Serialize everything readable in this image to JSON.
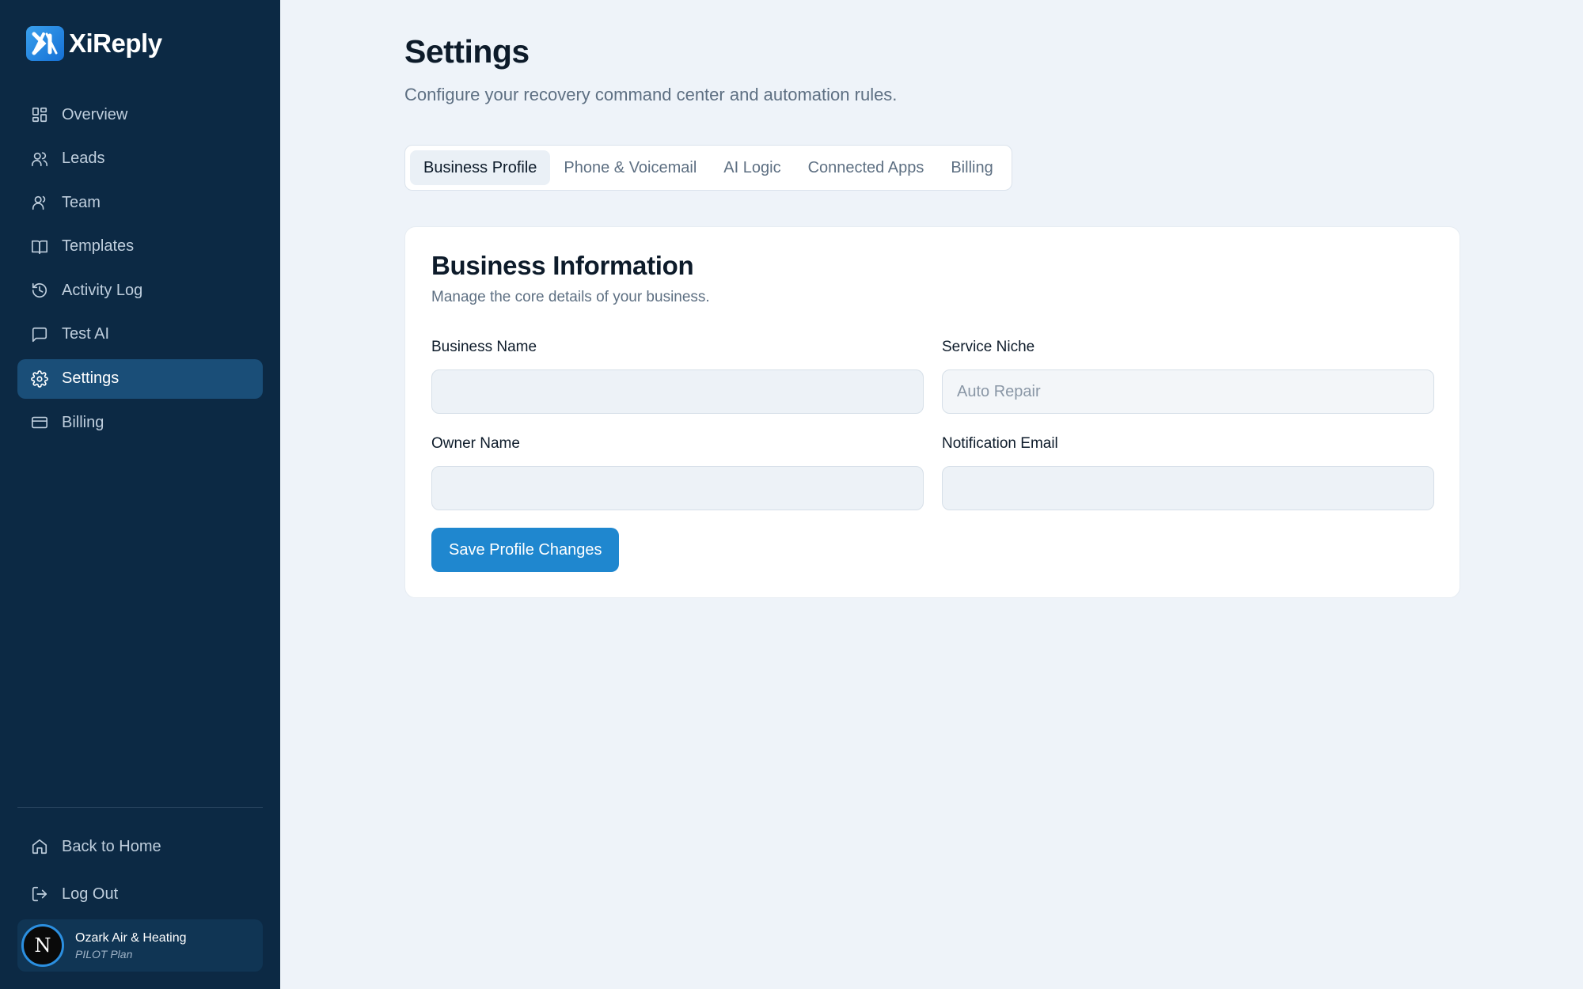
{
  "brand": {
    "name": "XiReply",
    "accent": "#1f87cf",
    "sidebar_bg": "#0c2944"
  },
  "sidebar": {
    "items": [
      {
        "label": "Overview",
        "icon": "dashboard-icon"
      },
      {
        "label": "Leads",
        "icon": "users-icon"
      },
      {
        "label": "Team",
        "icon": "team-icon"
      },
      {
        "label": "Templates",
        "icon": "book-icon"
      },
      {
        "label": "Activity Log",
        "icon": "history-icon"
      },
      {
        "label": "Test AI",
        "icon": "chat-icon"
      },
      {
        "label": "Settings",
        "icon": "gear-icon",
        "active": true
      },
      {
        "label": "Billing",
        "icon": "credit-card-icon"
      }
    ],
    "bottom": [
      {
        "label": "Back to Home",
        "icon": "home-icon"
      },
      {
        "label": "Log Out",
        "icon": "logout-icon"
      }
    ],
    "user": {
      "initial": "N",
      "name": "Ozark Air & Heating",
      "plan": "PILOT Plan"
    }
  },
  "page": {
    "title": "Settings",
    "subtitle": "Configure your recovery command center and automation rules."
  },
  "tabs": [
    {
      "label": "Business Profile",
      "active": true
    },
    {
      "label": "Phone & Voicemail"
    },
    {
      "label": "AI Logic"
    },
    {
      "label": "Connected Apps"
    },
    {
      "label": "Billing"
    }
  ],
  "card": {
    "title": "Business Information",
    "subtitle": "Manage the core details of your business.",
    "fields": {
      "business_name": {
        "label": "Business Name",
        "value": "",
        "placeholder": ""
      },
      "service_niche": {
        "label": "Service Niche",
        "value": "",
        "placeholder": "Auto Repair"
      },
      "owner_name": {
        "label": "Owner Name",
        "value": "",
        "placeholder": ""
      },
      "notification_email": {
        "label": "Notification Email",
        "value": "",
        "placeholder": ""
      }
    },
    "save_label": "Save Profile Changes"
  }
}
